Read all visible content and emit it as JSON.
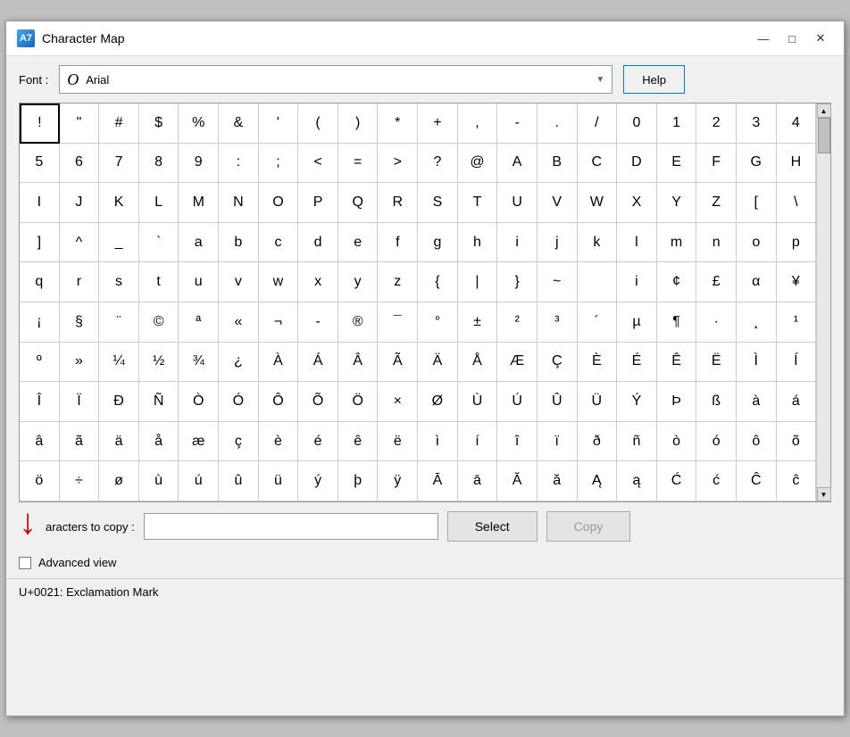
{
  "window": {
    "title": "Character Map",
    "icon_label": "A7"
  },
  "toolbar": {
    "font_label": "Font :",
    "font_icon": "O",
    "font_name": "Arial",
    "help_label": "Help"
  },
  "grid": {
    "characters": [
      "!",
      "\"",
      "#",
      "$",
      "%",
      "&",
      "'",
      "(",
      ")",
      "*",
      "+",
      ",",
      "-",
      ".",
      "/",
      "0",
      "1",
      "2",
      "3",
      "4",
      "5",
      "6",
      "7",
      "8",
      "9",
      ":",
      ";",
      "<",
      "=",
      ">",
      "?",
      "@",
      "A",
      "B",
      "C",
      "D",
      "E",
      "F",
      "G",
      "H",
      "I",
      "J",
      "K",
      "L",
      "M",
      "N",
      "O",
      "P",
      "Q",
      "R",
      "S",
      "T",
      "U",
      "V",
      "W",
      "X",
      "Y",
      "Z",
      "[",
      "\\",
      "]",
      "^",
      "_",
      "`",
      "a",
      "b",
      "c",
      "d",
      "e",
      "f",
      "g",
      "h",
      "i",
      "j",
      "k",
      "l",
      "m",
      "n",
      "o",
      "p",
      "q",
      "r",
      "s",
      "t",
      "u",
      "v",
      "w",
      "x",
      "y",
      "z",
      "{",
      "|",
      "}",
      "~",
      " ",
      "i",
      "¢",
      "£",
      "α",
      "¥",
      "¡",
      "§",
      "¨",
      "©",
      "ª",
      "«",
      "¬",
      "-",
      "®",
      "¯",
      "°",
      "±",
      "²",
      "³",
      "´",
      "µ",
      "¶",
      "·",
      "¸",
      "¹",
      "º",
      "»",
      "¼",
      "½",
      "¾",
      "¿",
      "À",
      "Á",
      "Â",
      "Ã",
      "Ä",
      "Å",
      "Æ",
      "Ç",
      "È",
      "É",
      "Ê",
      "Ë",
      "Ì",
      "Í",
      "Î",
      "Ï",
      "Ð",
      "Ñ",
      "Ò",
      "Ó",
      "Ô",
      "Õ",
      "Ö",
      "×",
      "Ø",
      "Ù",
      "Ú",
      "Û",
      "Ü",
      "Ý",
      "Þ",
      "ß",
      "à",
      "á",
      "â",
      "ã",
      "ä",
      "å",
      "æ",
      "ç",
      "è",
      "é",
      "ê",
      "ë",
      "ì",
      "í",
      "î",
      "ï",
      "ð",
      "ñ",
      "ò",
      "ó",
      "ô",
      "õ",
      "ö",
      "÷",
      "ø",
      "ù",
      "ú",
      "û",
      "ü",
      "ý",
      "þ",
      "ÿ",
      "Ā",
      "ā",
      "Ă",
      "ă",
      "Ą",
      "ą",
      "Ć",
      "ć",
      "Ĉ",
      "ĉ"
    ],
    "selected_index": 0
  },
  "bottom": {
    "copy_label": "aracters to copy :",
    "copy_placeholder": "",
    "select_label": "Select",
    "copy_btn_label": "Copy"
  },
  "advanced": {
    "checkbox_label": "Advanced view"
  },
  "status": {
    "text": "U+0021: Exclamation Mark"
  },
  "titlebar": {
    "minimize": "—",
    "maximize": "□",
    "close": "✕"
  }
}
